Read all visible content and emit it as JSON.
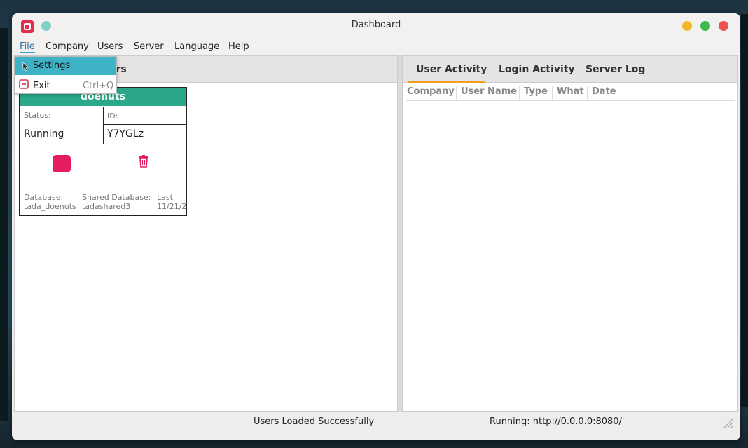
{
  "window": {
    "title": "Dashboard",
    "colors": {
      "close": "#e9534b",
      "maximize": "#3cba4a",
      "minimize": "#f3b72b",
      "teal_dot": "#7fd1c6"
    }
  },
  "menubar": {
    "items": [
      "File",
      "Company",
      "Users",
      "Server",
      "Language",
      "Help"
    ],
    "active": "File"
  },
  "file_menu": {
    "items": [
      {
        "label": "Settings",
        "shortcut": "",
        "icon": "cursor-icon",
        "highlighted": true
      },
      {
        "label": "Exit",
        "shortcut": "Ctrl+Q",
        "icon": "exit-icon",
        "highlighted": false
      }
    ]
  },
  "left_pane": {
    "header_suffix": "ers"
  },
  "server_card": {
    "name": "doenuts",
    "status_label": "Status:",
    "status_value": "Running",
    "id_label": "ID:",
    "id_value": "Y7YGLz",
    "database_label": "Database:",
    "database_value": "tada_doenuts",
    "shared_db_label": "Shared Database:",
    "shared_db_value": "tadashared3",
    "last_label": "Last",
    "last_value": "11/21/2",
    "stop_icon": "stop-icon",
    "delete_icon": "trash-icon",
    "colors": {
      "header": "#2ba78a",
      "stop": "#e51c5e"
    }
  },
  "right_pane": {
    "tabs": [
      "User Activity",
      "Login Activity",
      "Server Log"
    ],
    "active_tab": "User Activity",
    "columns": [
      "Company",
      "User Name",
      "Type",
      "What",
      "Date"
    ],
    "accent": "#f0a020"
  },
  "statusbar": {
    "message": "Users Loaded Successfully",
    "server": "Running: http://0.0.0.0:8080/"
  }
}
